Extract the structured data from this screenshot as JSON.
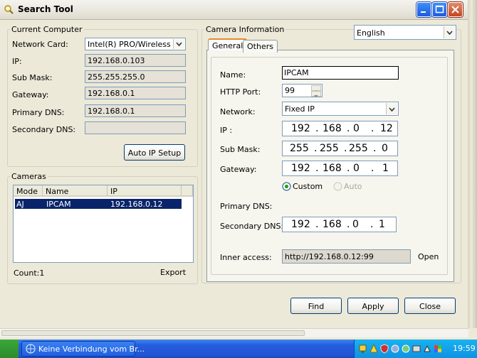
{
  "window": {
    "title": "Search Tool"
  },
  "current_computer": {
    "group_title": "Current Computer",
    "network_card_label": "Network Card:",
    "network_card_value": "Intel(R) PRO/Wireless LA",
    "ip_label": "IP:",
    "ip_value": "192.168.0.103",
    "submask_label": "Sub Mask:",
    "submask_value": "255.255.255.0",
    "gateway_label": "Gateway:",
    "gateway_value": "192.168.0.1",
    "primary_dns_label": "Primary DNS:",
    "primary_dns_value": "192.168.0.1",
    "secondary_dns_label": "Secondary DNS:",
    "secondary_dns_value": "",
    "auto_ip_button": "Auto IP Setup"
  },
  "cameras": {
    "group_title": "Cameras",
    "columns": [
      "Mode",
      "Name",
      "IP"
    ],
    "rows": [
      {
        "mode": "AJ",
        "name": "IPCAM",
        "ip": "192.168.0.12"
      }
    ],
    "count_label": "Count:1",
    "export_label": "Export"
  },
  "camera_info": {
    "group_title": "Camera Information",
    "language": "English",
    "tabs": [
      "General",
      "Others"
    ],
    "name_label": "Name:",
    "name_value": "IPCAM",
    "http_port_label": "HTTP Port:",
    "http_port_value": "99",
    "network_label": "Network:",
    "network_value": "Fixed IP",
    "ip_label": "IP  :",
    "ip_octets": [
      "192",
      "168",
      "0",
      "12"
    ],
    "submask_label": "Sub Mask:",
    "submask_octets": [
      "255",
      "255",
      "255",
      "0"
    ],
    "gateway_label": "Gateway:",
    "gateway_octets": [
      "192",
      "168",
      "0",
      "1"
    ],
    "dns_custom_label": "Custom",
    "dns_auto_label": "Auto",
    "primary_dns_label": "Primary DNS:",
    "secondary_dns_label": "Secondary DNS:",
    "secondary_dns_octets": [
      "192",
      "168",
      "0",
      "1"
    ],
    "inner_access_label": "Inner access:",
    "inner_access_value": "http://192.168.0.12:99",
    "open_label": "Open"
  },
  "buttons": {
    "find": "Find",
    "apply": "Apply",
    "close": "Close"
  },
  "taskbar": {
    "task_title": "Keine Verbindung vom Br...",
    "clock": "19:59"
  },
  "colors": {
    "selection": "#0a246a",
    "xp_blue": "#245edc",
    "tray_blue": "#0f92e3",
    "close_red": "#c3441e"
  }
}
